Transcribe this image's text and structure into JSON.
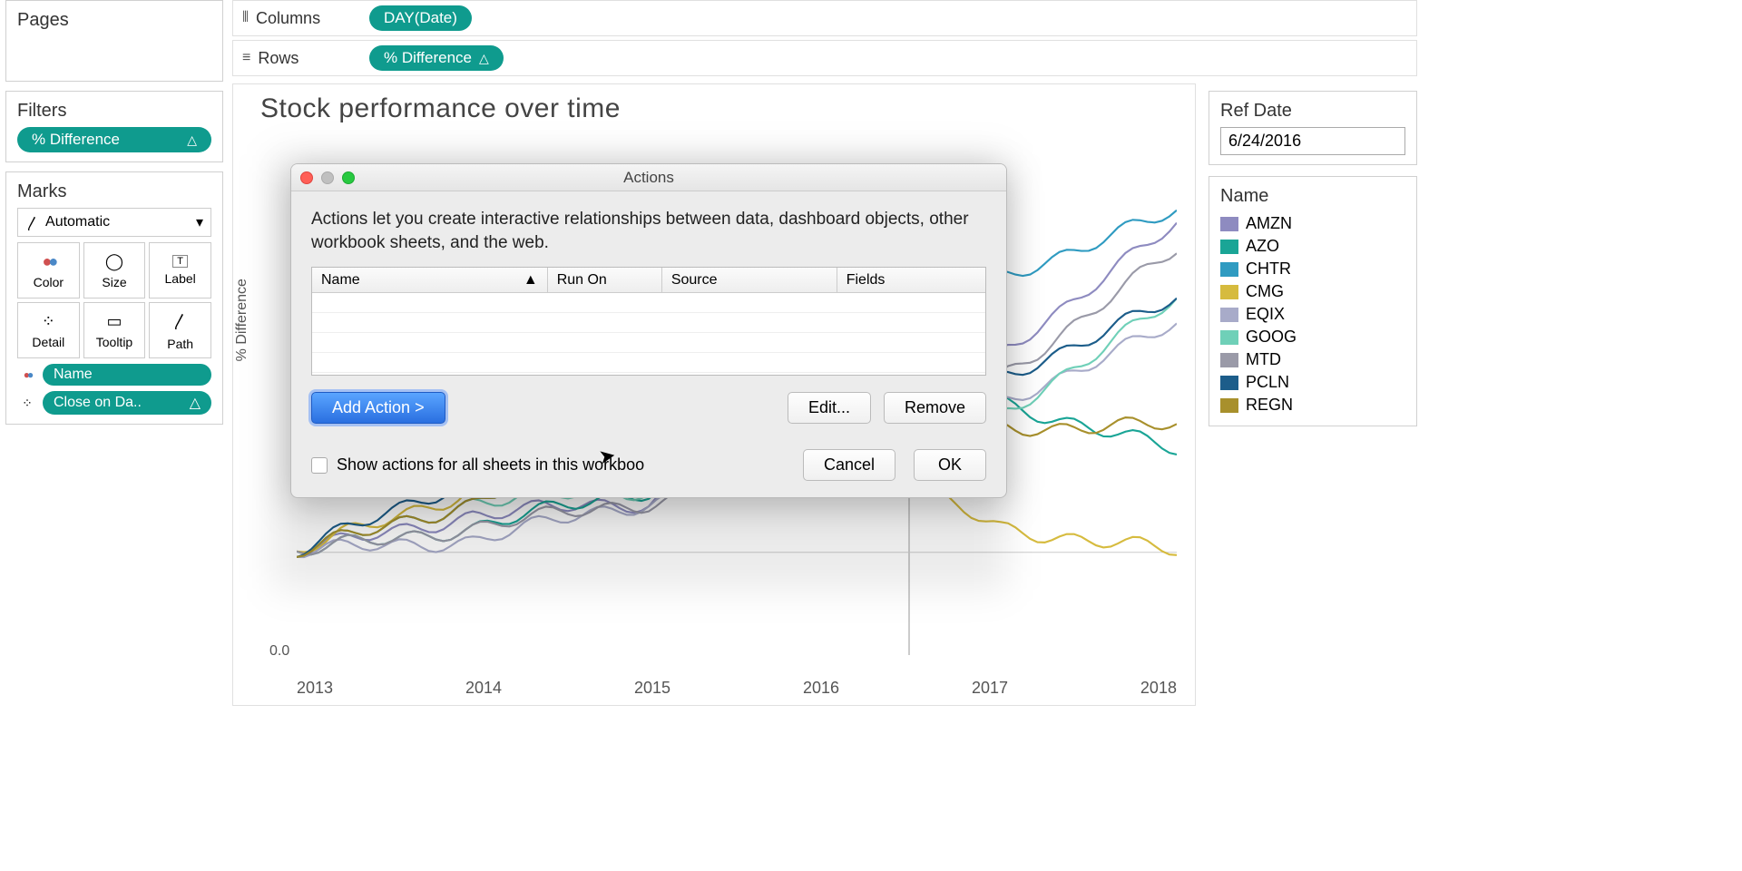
{
  "shelves": {
    "columns_label": "Columns",
    "rows_label": "Rows",
    "columns_pill": "DAY(Date)",
    "rows_pill": "% Difference"
  },
  "left": {
    "pages_title": "Pages",
    "filters_title": "Filters",
    "filter_pill": "% Difference",
    "marks_title": "Marks",
    "marks_type": "Automatic",
    "marks_cells": {
      "color": "Color",
      "size": "Size",
      "label": "Label",
      "detail": "Detail",
      "tooltip": "Tooltip",
      "path": "Path"
    },
    "mark_pill_name": "Name",
    "mark_pill_close": "Close on Da.."
  },
  "viz": {
    "title": "Stock performance over time",
    "y_axis": "% Difference",
    "y_tick0": "0.0",
    "x_ticks": [
      "2013",
      "2014",
      "2015",
      "2016",
      "2017",
      "2018"
    ]
  },
  "right": {
    "refdate_label": "Ref Date",
    "refdate_value": "6/24/2016",
    "legend_title": "Name",
    "legend": [
      {
        "name": "AMZN",
        "color": "#8e8bc0"
      },
      {
        "name": "AZO",
        "color": "#1aa596"
      },
      {
        "name": "CHTR",
        "color": "#2f9bc1"
      },
      {
        "name": "CMG",
        "color": "#d6bb3e"
      },
      {
        "name": "EQIX",
        "color": "#a8abc9"
      },
      {
        "name": "GOOG",
        "color": "#6fd0b8"
      },
      {
        "name": "MTD",
        "color": "#9a9aa8"
      },
      {
        "name": "PCLN",
        "color": "#1c5d8a"
      },
      {
        "name": "REGN",
        "color": "#a8902c"
      }
    ]
  },
  "dialog": {
    "title": "Actions",
    "desc": "Actions let you create interactive relationships between data, dashboard objects, other workbook sheets, and the web.",
    "cols": {
      "name": "Name",
      "run": "Run On",
      "source": "Source",
      "fields": "Fields"
    },
    "add": "Add Action >",
    "edit": "Edit...",
    "remove": "Remove",
    "show_all": "Show actions for all sheets in this workboo",
    "cancel": "Cancel",
    "ok": "OK"
  },
  "chart_data": {
    "type": "line",
    "title": "Stock performance over time",
    "xlabel": "",
    "ylabel": "% Difference",
    "x": [
      2013,
      2014,
      2015,
      2016,
      2017,
      2018
    ],
    "ylim": [
      -0.5,
      3.0
    ],
    "series": [
      {
        "name": "AMZN",
        "color": "#8e8bc0",
        "values": [
          0.0,
          0.3,
          0.4,
          1.2,
          1.6,
          2.6
        ]
      },
      {
        "name": "AZO",
        "color": "#1aa596",
        "values": [
          0.0,
          0.2,
          0.5,
          1.0,
          1.2,
          0.8
        ]
      },
      {
        "name": "CHTR",
        "color": "#2f9bc1",
        "values": [
          0.0,
          0.4,
          1.0,
          1.4,
          2.2,
          2.7
        ]
      },
      {
        "name": "CMG",
        "color": "#d6bb3e",
        "values": [
          0.0,
          0.5,
          1.0,
          0.8,
          0.2,
          0.0
        ]
      },
      {
        "name": "EQIX",
        "color": "#a8abc9",
        "values": [
          0.0,
          0.1,
          0.4,
          0.8,
          1.2,
          1.8
        ]
      },
      {
        "name": "GOOG",
        "color": "#6fd0b8",
        "values": [
          0.0,
          0.4,
          0.5,
          0.9,
          1.1,
          2.0
        ]
      },
      {
        "name": "MTD",
        "color": "#9a9aa8",
        "values": [
          0.0,
          0.2,
          0.4,
          0.7,
          1.4,
          2.4
        ]
      },
      {
        "name": "PCLN",
        "color": "#1c5d8a",
        "values": [
          0.0,
          0.6,
          0.7,
          1.0,
          1.4,
          2.0
        ]
      },
      {
        "name": "REGN",
        "color": "#a8902c",
        "values": [
          0.0,
          0.4,
          1.0,
          1.5,
          1.0,
          1.0
        ]
      }
    ]
  }
}
